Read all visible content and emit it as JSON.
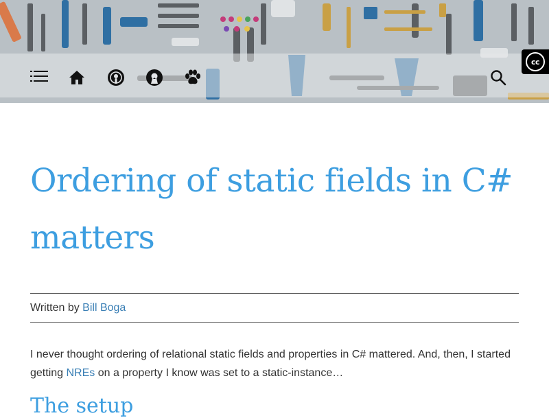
{
  "header": {
    "nav_icons": [
      "menu-icon",
      "home-icon",
      "podcast-icon",
      "open-source-icon",
      "paw-icon"
    ],
    "search_icon": "search-icon",
    "badge": {
      "label": "cc",
      "icon": "creative-commons-icon"
    }
  },
  "article": {
    "title": "Ordering of static fields in C# matters",
    "byline": {
      "prefix": "Written by ",
      "author": "Bill Boga"
    },
    "intro": {
      "text_before": "I never thought ordering of relational static fields and properties in C# mattered. And, then, I started getting ",
      "link": "NREs",
      "text_after": " on a property I know was set to a static-instance…"
    },
    "section_heading": "The setup"
  },
  "colors": {
    "title": "#3d9ee0",
    "link": "#3a7fb5",
    "text": "#333333",
    "badge_bg": "#000000"
  }
}
